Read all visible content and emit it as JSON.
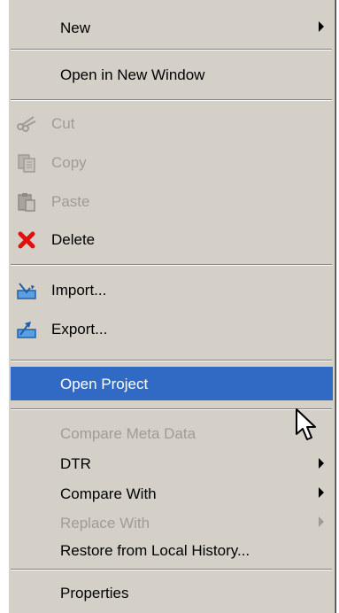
{
  "menu": {
    "new": "New",
    "open_new_window": "Open in New Window",
    "cut": "Cut",
    "copy": "Copy",
    "paste": "Paste",
    "delete": "Delete",
    "import": "Import...",
    "export": "Export...",
    "open_project": "Open Project",
    "compare_meta": "Compare Meta Data",
    "dtr": "DTR",
    "compare_with": "Compare With",
    "replace_with": "Replace With",
    "restore": "Restore from Local History...",
    "properties": "Properties"
  },
  "colors": {
    "menu_bg": "#d4d0c8",
    "highlight": "#316ac5",
    "disabled_text": "#a09c94"
  },
  "icons": [
    "scissors-icon",
    "copy-icon",
    "paste-icon",
    "delete-x-icon",
    "import-icon",
    "export-icon",
    "submenu-arrow-icon",
    "mouse-cursor-icon"
  ]
}
